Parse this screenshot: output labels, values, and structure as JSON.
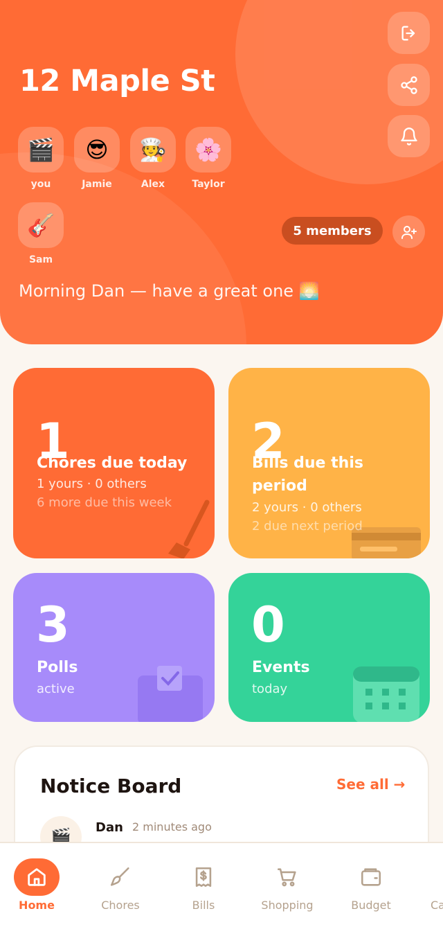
{
  "header": {
    "title": "12 Maple St",
    "greeting": "Morning Dan — have a great one 🌅",
    "members_count_label": "5 members",
    "actions": [
      {
        "icon": "logout-icon"
      },
      {
        "icon": "share-icon"
      },
      {
        "icon": "bell-icon"
      }
    ],
    "add_member_icon": "add-user-icon"
  },
  "members": [
    {
      "name": "you",
      "avatar": "🎬"
    },
    {
      "name": "Jamie",
      "avatar": "😎"
    },
    {
      "name": "Alex",
      "avatar": "🧑‍🍳"
    },
    {
      "name": "Taylor",
      "avatar": "🌸"
    },
    {
      "name": "Sam",
      "avatar": "🎸"
    }
  ],
  "stats": {
    "chores": {
      "value": "1",
      "label": "Chores due today",
      "detail": "1 yours · 0 others",
      "extra": "6 more due this week",
      "color": "#ff6b35",
      "icon": "broom-icon"
    },
    "bills": {
      "value": "2",
      "label_line1": "Bills due this",
      "label_line2": "period",
      "detail": "2 yours · 0 others",
      "extra": "2 due next period",
      "color": "#ffb347",
      "icon": "credit-card-icon"
    },
    "polls": {
      "value": "3",
      "label": "Polls",
      "detail": "active",
      "color": "#a78bfa",
      "icon": "ballot-box-icon"
    },
    "events": {
      "value": "0",
      "label": "Events",
      "detail": "today",
      "color": "#34d399",
      "icon": "calendar-icon"
    }
  },
  "notice_board": {
    "title": "Notice Board",
    "see_all": "See all →",
    "posts": [
      {
        "author": "Dan",
        "time": "2 minutes ago",
        "avatar": "🎬"
      }
    ]
  },
  "nav": {
    "items": [
      {
        "label": "Home",
        "icon": "home-icon",
        "active": true
      },
      {
        "label": "Chores",
        "icon": "brush-icon"
      },
      {
        "label": "Bills",
        "icon": "receipt-icon"
      },
      {
        "label": "Shopping",
        "icon": "cart-icon"
      },
      {
        "label": "Budget",
        "icon": "wallet-icon"
      },
      {
        "label": "Ca",
        "icon": "calendar-icon"
      }
    ]
  },
  "colors": {
    "accent": "#ff6b35",
    "background": "#fbf6f0"
  }
}
